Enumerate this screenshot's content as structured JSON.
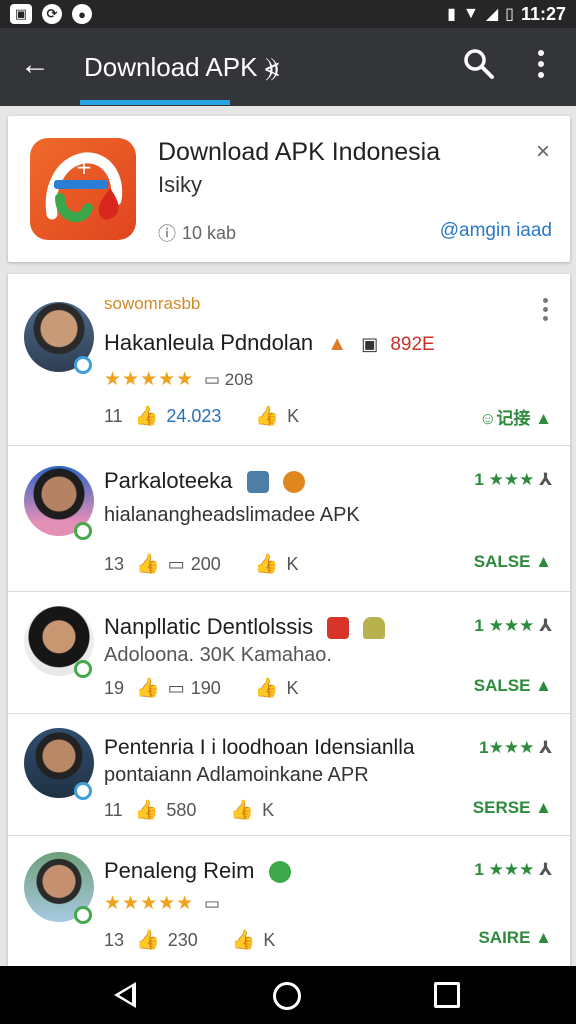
{
  "statusbar": {
    "time": "11:27"
  },
  "appbar": {
    "title": "Download APK ⦖"
  },
  "ad": {
    "title": "Download APK Indonesia",
    "subtitle": "Isiky",
    "meta": "10 kab",
    "link": "@amgin iaad",
    "close": "×"
  },
  "posts": [
    {
      "handle": "sowomrasbb",
      "title": "Hakanleula Pdndolan",
      "chip_text": "892E",
      "stars": "★★★★★",
      "count": "208",
      "likes": "11",
      "views": "24.023",
      "k": "K",
      "tag": "☺记接"
    },
    {
      "title": "Parkaloteeka",
      "rating": "1 ★★★",
      "desc": "hialanangheadslimadee  APK",
      "likes": "13",
      "views": "200",
      "k": "K",
      "tag": "SALSE"
    },
    {
      "title": "Nanpllatic Dentlolssis",
      "rating": "1 ★★★",
      "desc": "Adoloona. 30K Kamahao.",
      "likes": "19",
      "views": "190",
      "k": "K",
      "tag": "SALSE"
    },
    {
      "title": "Pentenria I i loodhoan Idensianlla",
      "rating": "1★★★",
      "desc": "pontaiann Adlamoinkane APR",
      "likes": "11",
      "views": "580",
      "k": "K",
      "tag": "SERSE"
    },
    {
      "title": "Penaleng Reim",
      "rating": "1 ★★★",
      "stars": "★★★★★",
      "likes": "13",
      "views": "230",
      "k": "K",
      "tag": "SAIRE"
    }
  ]
}
